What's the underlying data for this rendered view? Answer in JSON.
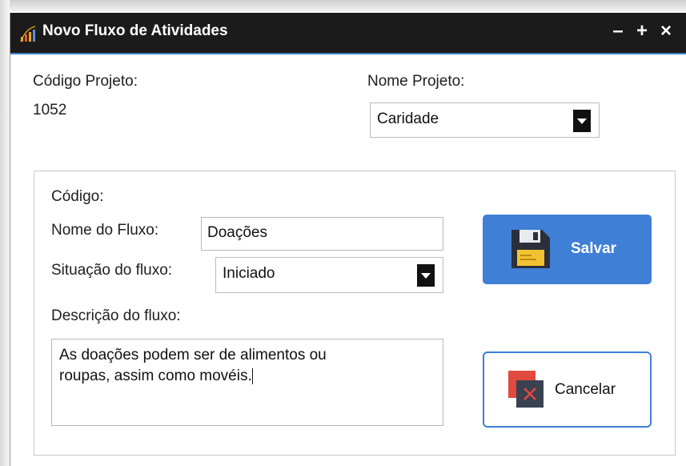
{
  "window": {
    "title": "Novo Fluxo de Atividades",
    "icon": "bar-chart-icon",
    "controls": {
      "minimize": "–",
      "maximize": "+",
      "close": "×"
    }
  },
  "project": {
    "code_label": "Código Projeto:",
    "code_value": "1052",
    "name_label": "Nome Projeto:",
    "name_value": "Caridade"
  },
  "form": {
    "codigo_label": "Código:",
    "nome_label": "Nome do Fluxo:",
    "nome_value": "Doações",
    "situacao_label": "Situação do fluxo:",
    "situacao_value": "Iniciado",
    "descricao_label": "Descrição do fluxo:",
    "descricao_line1": "As doações podem ser de alimentos ou",
    "descricao_line2": "roupas, assim como movéis."
  },
  "buttons": {
    "save_label": "Salvar",
    "save_icon": "floppy-disk-icon",
    "cancel_label": "Cancelar",
    "cancel_icon": "cancel-x-icon"
  },
  "colors": {
    "titlebar": "#1b1b1b",
    "accent": "#3f7fd6",
    "cancel_icon": "#e04a3f"
  }
}
